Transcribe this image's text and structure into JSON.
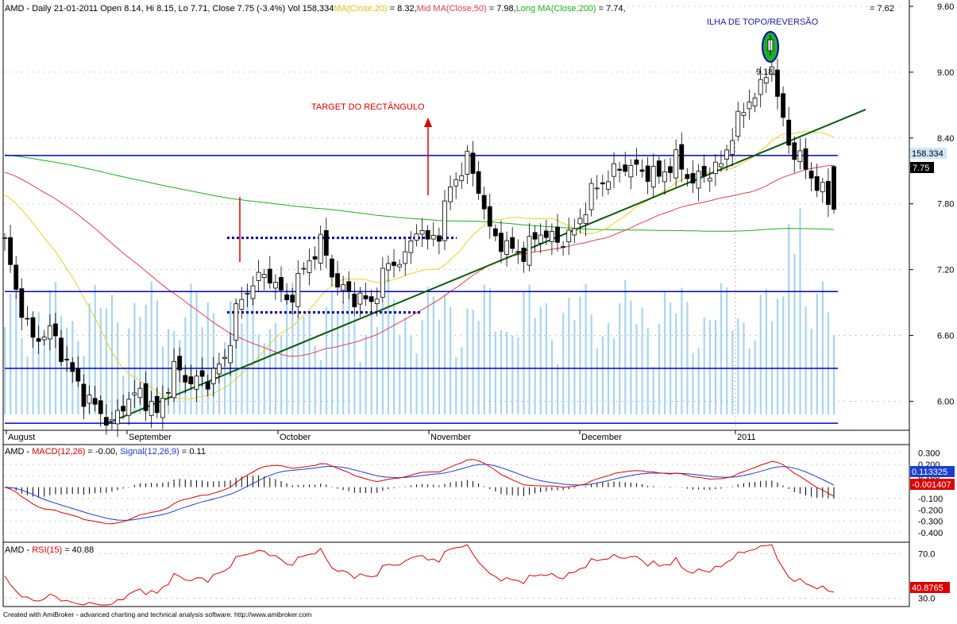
{
  "app": {
    "footer": "Created with AmiBroker - advanced charting and technical analysis software. http://www.amibroker.com"
  },
  "colors": {
    "background": "#ffffff",
    "candle_up_fill": "#ffffff",
    "candle_down_fill": "#000000",
    "volume": "#a8d4f0",
    "ma20": "#e6d02a",
    "ma50": "#e0404a",
    "ma200": "#1fae1f",
    "support_lines": "#0000cc",
    "trendline": "#0b5a0b",
    "rect_dots": "#0000aa",
    "target_arrow": "#dd0000",
    "macd": "#dd0000",
    "signal": "#1a3fd0",
    "rsi": "#dd0000",
    "axis_text": "#000000"
  },
  "chart_data": [
    {
      "type": "candlestick",
      "title": "AMD - Daily 21-01-2011",
      "header": {
        "prefix": "AMD - Daily 21-01-2011 Open 8.14, Hi 8.15, Lo 7.71, Close 7.75 (-3.4%) Vol 158,334",
        "ma20_label": "MA(Close,20)",
        "ma20_value": " = 8.32,",
        "ma50_label": "Mid MA(Close,50)",
        "ma50_value": " = 7.98,",
        "ma200_label": "Long MA(Close,200)",
        "ma200_value": " = 7.74,"
      },
      "right_header_value": "= 7.62",
      "ohlc_y_range": [
        5.75,
        9.6
      ],
      "y_ticks": [
        "9.60",
        "9.00",
        "8.40",
        "7.80",
        "7.20",
        "6.60",
        "6.00"
      ],
      "x_labels": [
        "August",
        "September",
        "October",
        "November",
        "December",
        "2011"
      ],
      "volume_value": "158.334",
      "close_value": "7.75",
      "last_ohlc": {
        "open": 8.14,
        "high": 8.15,
        "low": 7.71,
        "close": 7.75
      },
      "horizontal_lines": [
        8.24,
        7.0,
        6.3,
        5.8
      ],
      "rectangle": {
        "top": 7.49,
        "bottom": 6.81
      },
      "trendline": {
        "start": 5.79,
        "end": 8.66
      },
      "annotations": {
        "target": "TARGET DO RECTÂNGULO",
        "island": "ILHA DE TOPO/REVERSÃO",
        "island_value": "9.18,"
      }
    },
    {
      "type": "line",
      "title": "AMD - MACD(12,26) = -0.00, Signal(12,26,9) = 0.11",
      "label_prefix": "AMD - ",
      "macd_label": "MACD(12,26)",
      "macd_value": " = -0.00, ",
      "signal_label": "Signal(12,26,9)",
      "signal_value": " = 0.11",
      "y_range": [
        -0.47,
        0.36
      ],
      "y_ticks": [
        "0.300",
        "0.200",
        "0.100",
        "-0.100",
        "-0.200",
        "-0.300",
        "-0.400"
      ],
      "signal_value_box": "0.113325",
      "macd_value_box": "-0.001407"
    },
    {
      "type": "line",
      "title": "AMD - RSI(15) = 40.88",
      "label_prefix": "AMD - ",
      "rsi_label": "RSI(15)",
      "rsi_value": " = 40.88",
      "y_range": [
        24,
        78
      ],
      "y_ticks": [
        "70.0",
        "30.0"
      ],
      "value_box": "40.8765"
    }
  ]
}
